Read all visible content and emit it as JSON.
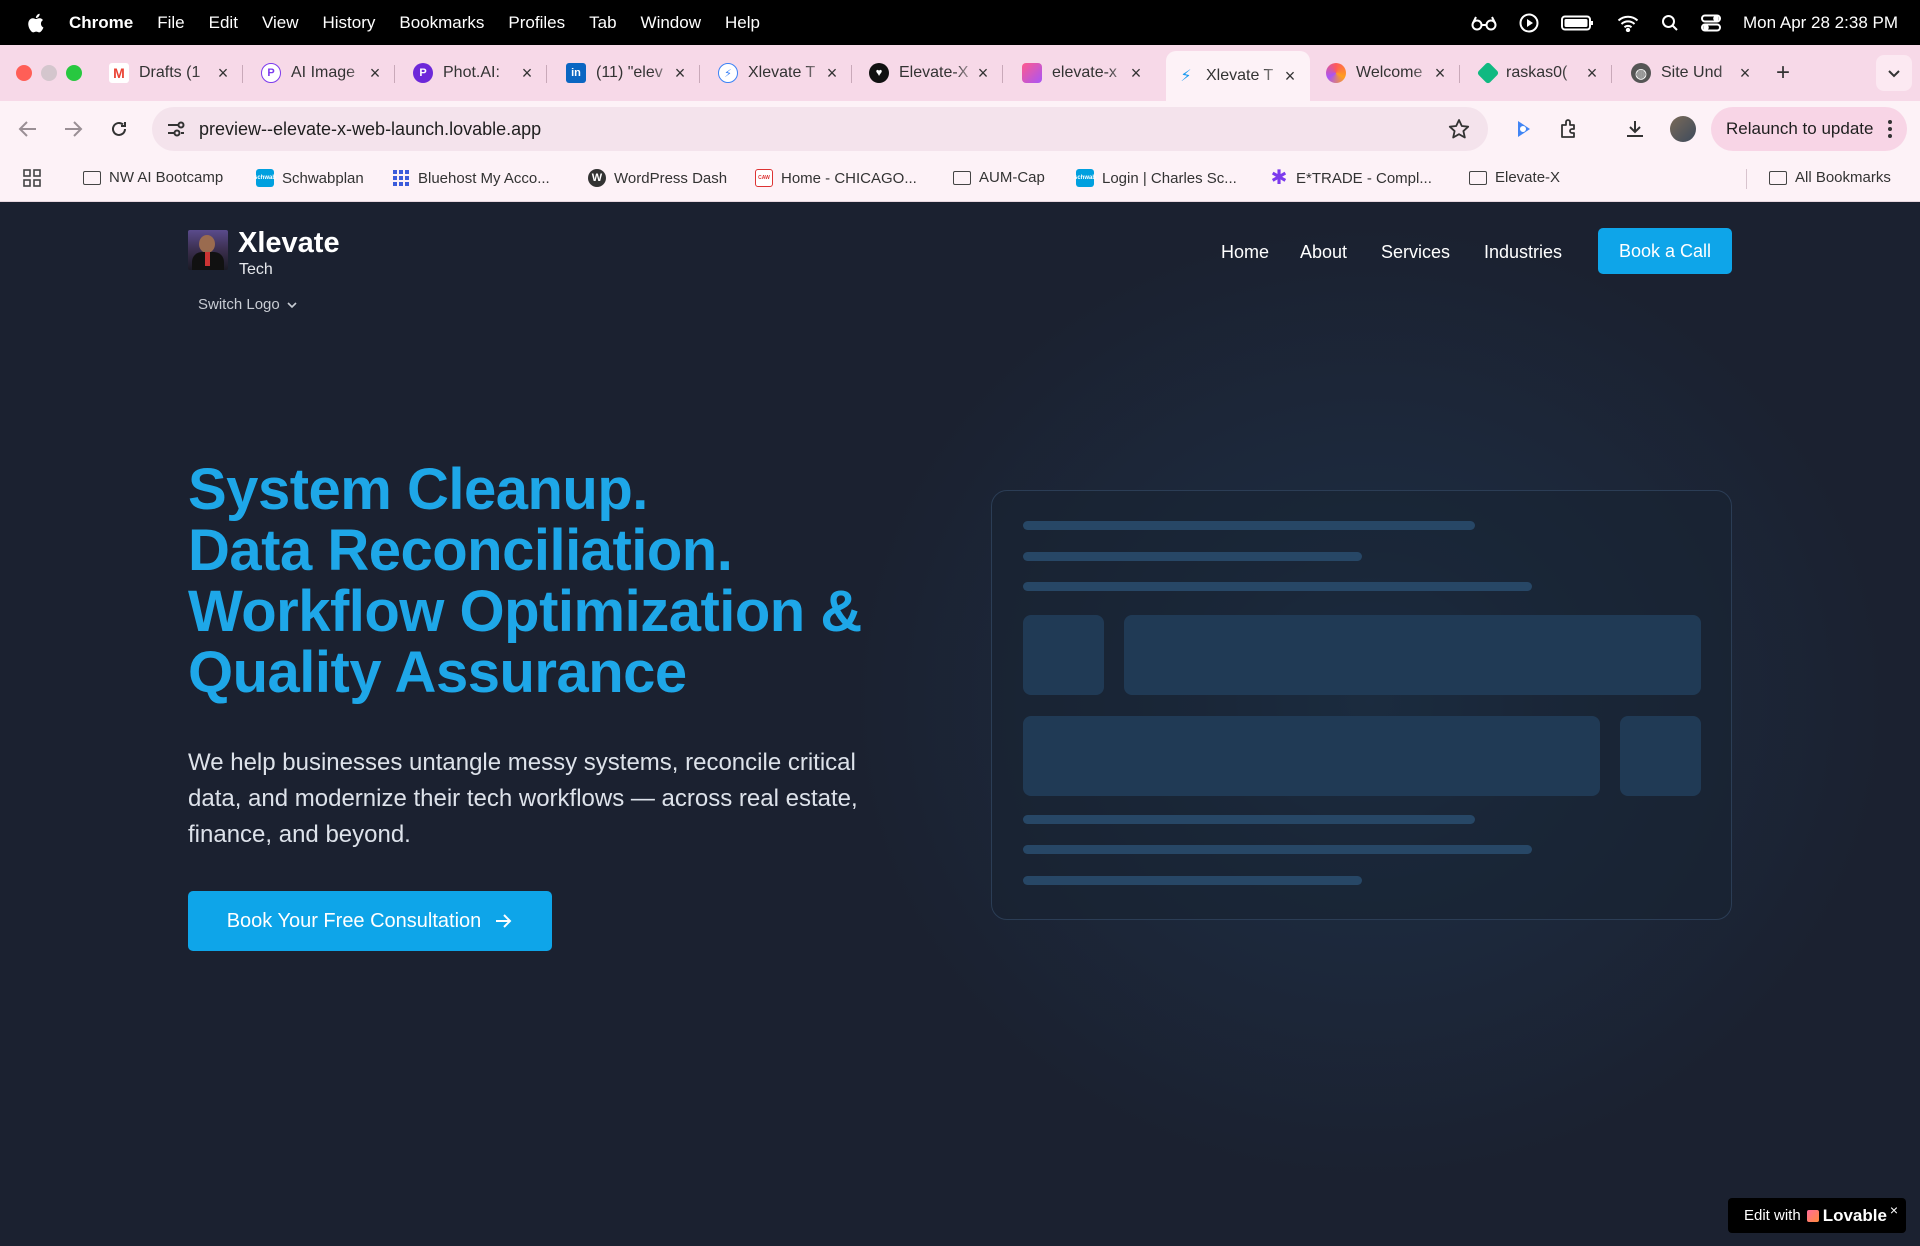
{
  "menubar": {
    "items": [
      "Chrome",
      "File",
      "Edit",
      "View",
      "History",
      "Bookmarks",
      "Profiles",
      "Tab",
      "Window",
      "Help"
    ],
    "clock": "Mon Apr 28  2:38 PM"
  },
  "tabs": [
    {
      "label": "Drafts (1",
      "icon": "gmail-icon"
    },
    {
      "label": "AI Image",
      "icon": "p-icon"
    },
    {
      "label": "Phot.AI:",
      "icon": "p-icon"
    },
    {
      "label": "(11) \"elev",
      "icon": "linkedin-icon"
    },
    {
      "label": "Xlevate T",
      "icon": "bolt-icon"
    },
    {
      "label": "Elevate-X",
      "icon": "heart-icon"
    },
    {
      "label": "elevate-x",
      "icon": "lovable-icon"
    },
    {
      "label": "Xlevate T",
      "icon": "bolt-icon",
      "active": true
    },
    {
      "label": "Welcome",
      "icon": "swirl-icon"
    },
    {
      "label": "raskas0(",
      "icon": "diamond-icon"
    },
    {
      "label": "Site Und",
      "icon": "globe-icon"
    }
  ],
  "toolbar": {
    "url": "preview--elevate-x-web-launch.lovable.app",
    "relaunch_label": "Relaunch to update"
  },
  "bookmarks": [
    {
      "label": "NW AI Bootcamp",
      "icon": "folder-icon"
    },
    {
      "label": "Schwabplan",
      "icon": "schwab-icon"
    },
    {
      "label": "Bluehost My Acco...",
      "icon": "grid-icon"
    },
    {
      "label": "WordPress Dash",
      "icon": "wordpress-icon"
    },
    {
      "label": "Home - CHICAGO...",
      "icon": "caw-icon"
    },
    {
      "label": "AUM-Cap",
      "icon": "folder-icon"
    },
    {
      "label": "Login | Charles Sc...",
      "icon": "schwab-icon"
    },
    {
      "label": "E*TRADE - Compl...",
      "icon": "etrade-icon"
    },
    {
      "label": "Elevate-X",
      "icon": "folder-icon"
    },
    {
      "label": "All Bookmarks",
      "icon": "folder-icon"
    }
  ],
  "site": {
    "brand": {
      "name": "Xlevate",
      "sub": "Tech",
      "switch_logo": "Switch Logo"
    },
    "nav": [
      "Home",
      "About",
      "Services",
      "Industries"
    ],
    "cta_top": "Book a Call",
    "hero": {
      "title_lines": [
        "System Cleanup.",
        "Data Reconciliation.",
        "Workflow Optimization &",
        "Quality Assurance"
      ],
      "subtitle": "We help businesses untangle messy systems, reconcile critical data, and modernize their tech workflows — across real estate, finance, and beyond.",
      "cta": "Book Your Free Consultation"
    },
    "accent_color": "#0ea5e9",
    "background_color": "#1b2130"
  },
  "lovable_badge": {
    "prefix": "Edit with",
    "brand": "Lovable",
    "close": "×"
  }
}
